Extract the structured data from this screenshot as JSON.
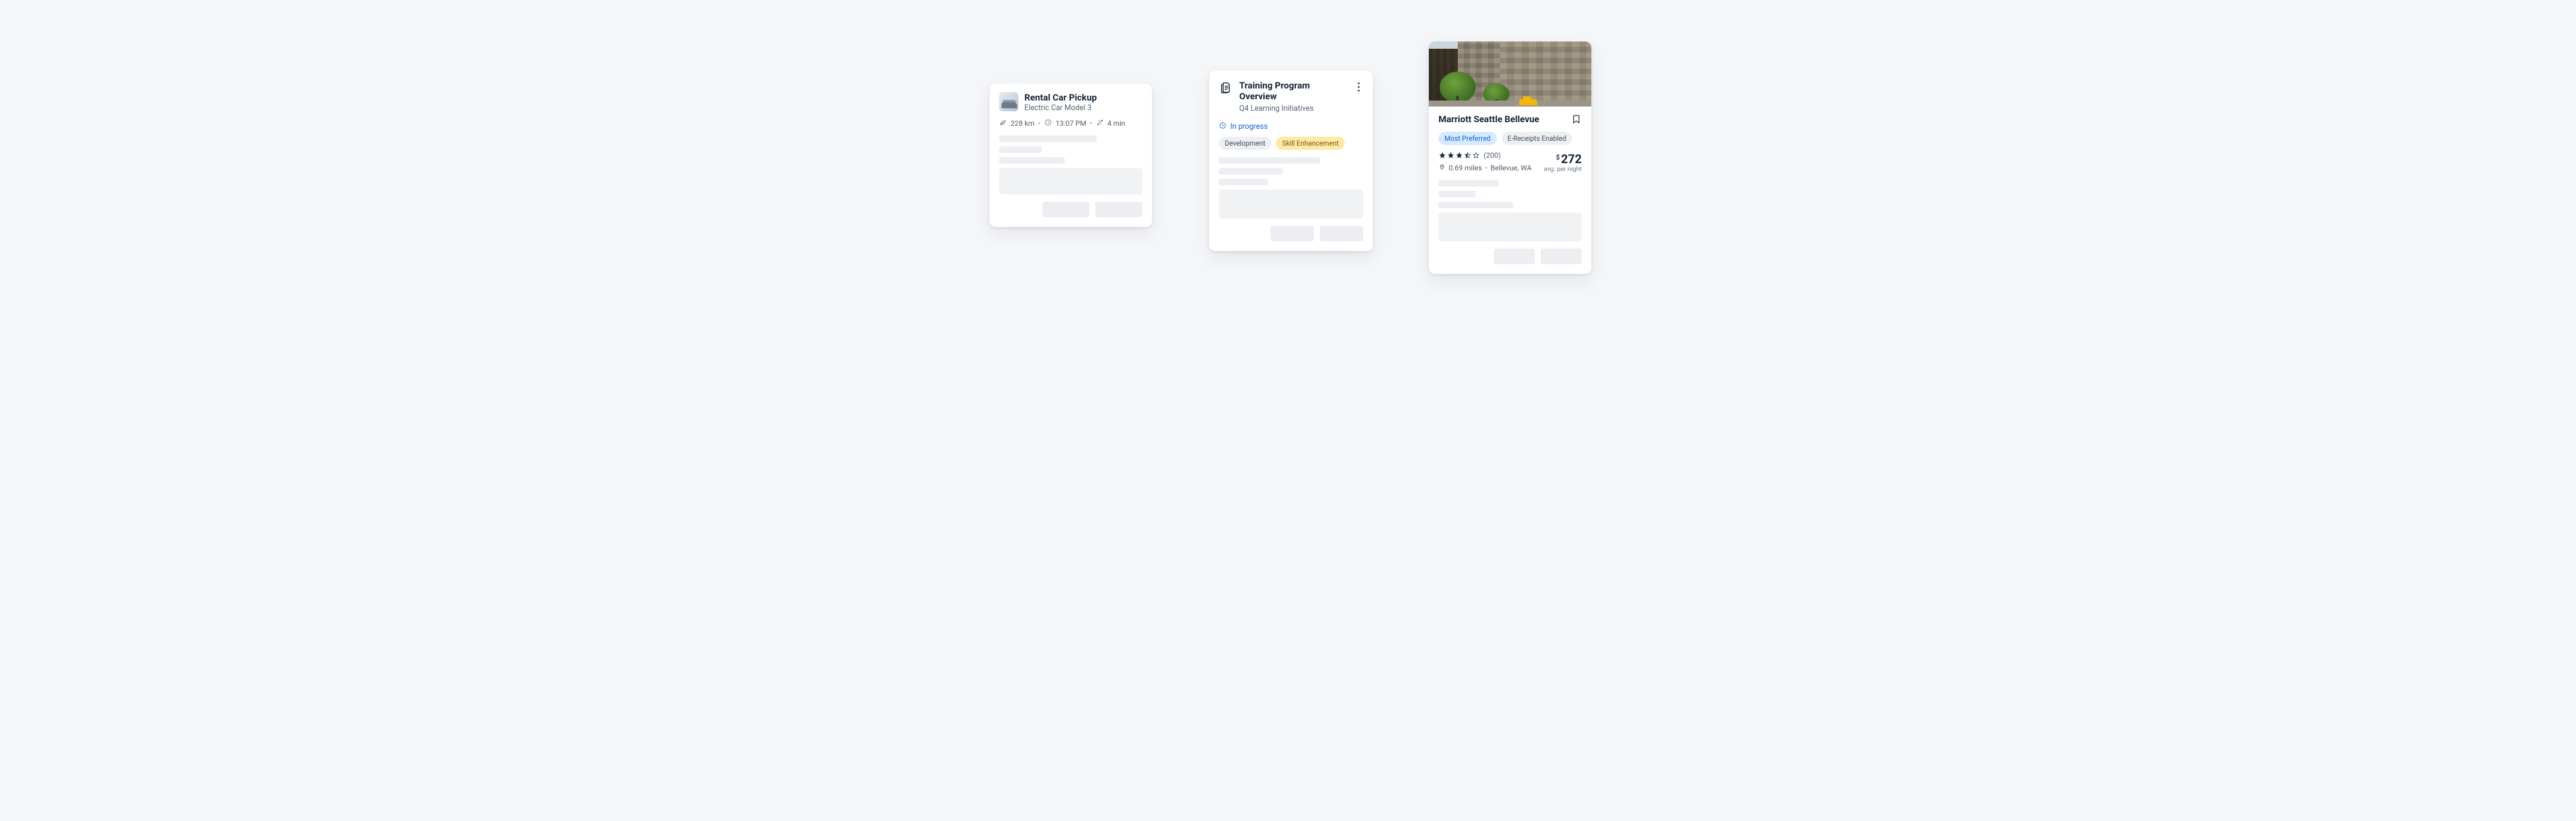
{
  "rental": {
    "title": "Rental Car Pickup",
    "subtitle": "Electric Car Model 3",
    "distance": "228 km",
    "time": "13:07 PM",
    "eta": "4 min"
  },
  "training": {
    "title": "Training Program Overview",
    "subtitle": "Q4 Learning Initiatives",
    "status": "In progress",
    "chips": {
      "dev": "Development",
      "skill": "Skill Enhancement"
    }
  },
  "hotel": {
    "name": "Marriott Seattle Bellevue",
    "chips": {
      "preferred": "Most Preferred",
      "ereceipts": "E-Receipts Enabled"
    },
    "reviews": "(200)",
    "distance": "0.69 miles",
    "city": "Bellevue, WA",
    "currency": "$",
    "price": "272",
    "price_sub": "avg. per night"
  }
}
